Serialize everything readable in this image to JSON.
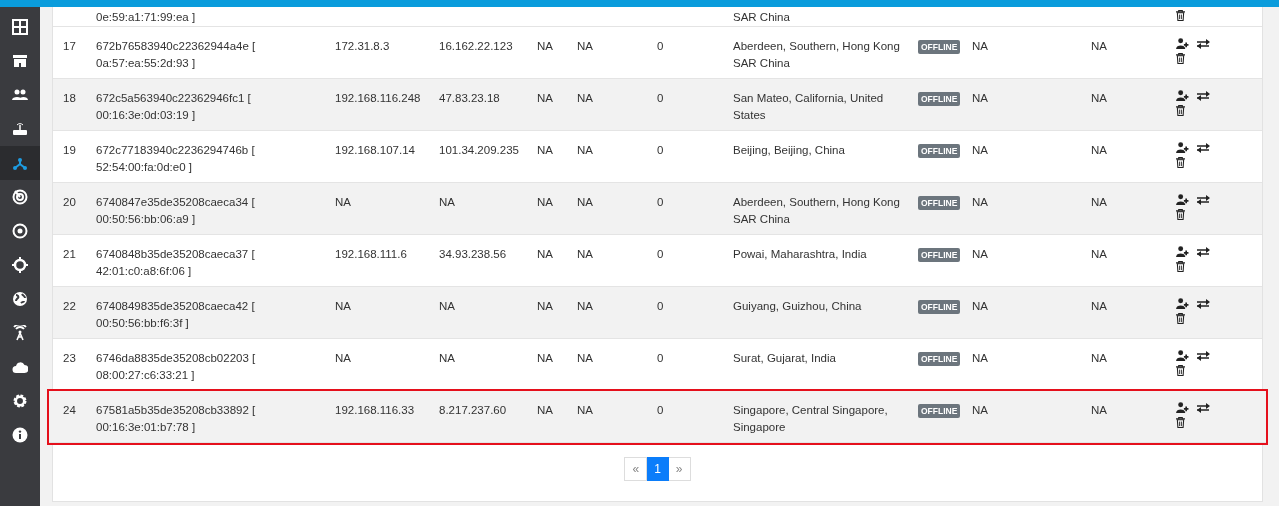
{
  "sidebar": {
    "items": [
      {
        "selected": false
      },
      {
        "selected": false
      },
      {
        "selected": false
      },
      {
        "selected": false
      },
      {
        "selected": true
      },
      {
        "selected": false
      },
      {
        "selected": false
      },
      {
        "selected": false
      },
      {
        "selected": false
      },
      {
        "selected": false
      },
      {
        "selected": false
      },
      {
        "selected": false
      },
      {
        "selected": false
      }
    ]
  },
  "table": {
    "partial_row": {
      "mac": "0e:59:a1:71:99:ea ]",
      "location": "SAR China"
    },
    "rows": [
      {
        "number": "17",
        "device_id": "672b76583940c22362944a4e [",
        "mac": "0a:57:ea:55:2d:93 ]",
        "local_ip": "172.31.8.3",
        "public_ip": "16.162.22.123",
        "column_5": "NA",
        "column_6": "NA",
        "column_7": "0",
        "location": "Aberdeen, Southern, Hong Kong SAR China",
        "status": "OFFLINE",
        "column_10": "NA",
        "column_11": "NA",
        "highlighted": false
      },
      {
        "number": "18",
        "device_id": "672c5a563940c22362946fc1 [",
        "mac": "00:16:3e:0d:03:19 ]",
        "local_ip": "192.168.116.248",
        "public_ip": "47.83.23.18",
        "column_5": "NA",
        "column_6": "NA",
        "column_7": "0",
        "location": "San Mateo, California, United States",
        "status": "OFFLINE",
        "column_10": "NA",
        "column_11": "NA",
        "highlighted": false
      },
      {
        "number": "19",
        "device_id": "672c77183940c2236294746b [",
        "mac": "52:54:00:fa:0d:e0 ]",
        "local_ip": "192.168.107.14",
        "public_ip": "101.34.209.235",
        "column_5": "NA",
        "column_6": "NA",
        "column_7": "0",
        "location": "Beijing, Beijing, China",
        "status": "OFFLINE",
        "column_10": "NA",
        "column_11": "NA",
        "highlighted": false
      },
      {
        "number": "20",
        "device_id": "6740847e35de35208caeca34 [",
        "mac": "00:50:56:bb:06:a9 ]",
        "local_ip": "NA",
        "public_ip": "NA",
        "column_5": "NA",
        "column_6": "NA",
        "column_7": "0",
        "location": "Aberdeen, Southern, Hong Kong SAR China",
        "status": "OFFLINE",
        "column_10": "NA",
        "column_11": "NA",
        "highlighted": false
      },
      {
        "number": "21",
        "device_id": "6740848b35de35208caeca37 [",
        "mac": "42:01:c0:a8:6f:06 ]",
        "local_ip": "192.168.111.6",
        "public_ip": "34.93.238.56",
        "column_5": "NA",
        "column_6": "NA",
        "column_7": "0",
        "location": "Powai, Maharashtra, India",
        "status": "OFFLINE",
        "column_10": "NA",
        "column_11": "NA",
        "highlighted": false
      },
      {
        "number": "22",
        "device_id": "6740849835de35208caeca42 [",
        "mac": "00:50:56:bb:f6:3f ]",
        "local_ip": "NA",
        "public_ip": "NA",
        "column_5": "NA",
        "column_6": "NA",
        "column_7": "0",
        "location": "Guiyang, Guizhou, China",
        "status": "OFFLINE",
        "column_10": "NA",
        "column_11": "NA",
        "highlighted": false
      },
      {
        "number": "23",
        "device_id": "6746da8835de35208cb02203 [",
        "mac": "08:00:27:c6:33:21 ]",
        "local_ip": "NA",
        "public_ip": "NA",
        "column_5": "NA",
        "column_6": "NA",
        "column_7": "0",
        "location": "Surat, Gujarat, India",
        "status": "OFFLINE",
        "column_10": "NA",
        "column_11": "NA",
        "highlighted": false
      },
      {
        "number": "24",
        "device_id": "67581a5b35de35208cb33892 [",
        "mac": "00:16:3e:01:b7:78 ]",
        "local_ip": "192.168.116.33",
        "public_ip": "8.217.237.60",
        "column_5": "NA",
        "column_6": "NA",
        "column_7": "0",
        "location": "Singapore, Central Singapore, Singapore",
        "status": "OFFLINE",
        "column_10": "NA",
        "column_11": "NA",
        "highlighted": true
      }
    ]
  },
  "pagination": {
    "previous": "«",
    "pages": [
      {
        "label": "1",
        "selected": true
      }
    ],
    "next": "»"
  }
}
